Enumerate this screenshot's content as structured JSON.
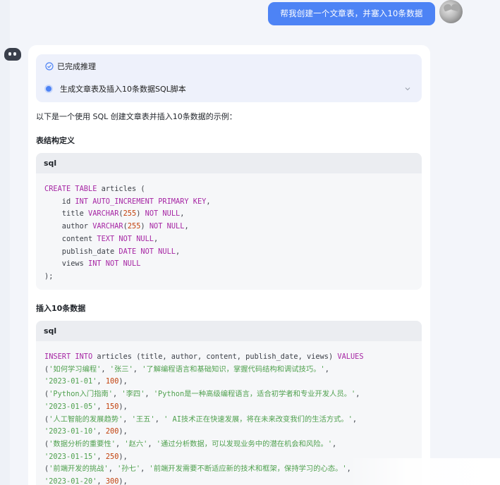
{
  "user_message": "帮我创建一个文章表，并塞入10条数据",
  "reasoning": {
    "status": "已完成推理",
    "step": "生成文章表及插入10条数据SQL脚本"
  },
  "response": {
    "intro": "以下是一个使用 SQL 创建文章表并插入10条数据的示例：",
    "section1_title": "表结构定义",
    "section2_title": "插入10条数据"
  },
  "code_blocks": [
    {
      "lang": "sql",
      "lines": [
        [
          [
            "kw",
            "CREATE TABLE"
          ],
          [
            "p",
            " articles ("
          ]
        ],
        [
          [
            "p",
            "    id "
          ],
          [
            "kw",
            "INT AUTO_INCREMENT PRIMARY KEY"
          ],
          [
            "p",
            ","
          ]
        ],
        [
          [
            "p",
            "    title "
          ],
          [
            "kw",
            "VARCHAR"
          ],
          [
            "p",
            "("
          ],
          [
            "num",
            "255"
          ],
          [
            "p",
            ") "
          ],
          [
            "kw",
            "NOT NULL"
          ],
          [
            "p",
            ","
          ]
        ],
        [
          [
            "p",
            "    author "
          ],
          [
            "kw",
            "VARCHAR"
          ],
          [
            "p",
            "("
          ],
          [
            "num",
            "255"
          ],
          [
            "p",
            ") "
          ],
          [
            "kw",
            "NOT NULL"
          ],
          [
            "p",
            ","
          ]
        ],
        [
          [
            "p",
            "    content "
          ],
          [
            "kw",
            "TEXT NOT NULL"
          ],
          [
            "p",
            ","
          ]
        ],
        [
          [
            "p",
            "    publish_date "
          ],
          [
            "kw",
            "DATE NOT NULL"
          ],
          [
            "p",
            ","
          ]
        ],
        [
          [
            "p",
            "    views "
          ],
          [
            "kw",
            "INT NOT NULL"
          ]
        ],
        [
          [
            "p",
            ");"
          ]
        ]
      ]
    },
    {
      "lang": "sql",
      "lines": [
        [
          [
            "kw",
            "INSERT INTO"
          ],
          [
            "p",
            " articles (title, author, content, publish_date, views) "
          ],
          [
            "kw",
            "VALUES"
          ]
        ],
        [
          [
            "p",
            "("
          ],
          [
            "str",
            "'如何学习编程'"
          ],
          [
            "p",
            ", "
          ],
          [
            "str",
            "'张三'"
          ],
          [
            "p",
            ", "
          ],
          [
            "str",
            "'了解编程语言和基础知识，掌握代码结构和调试技巧。'"
          ],
          [
            "p",
            ","
          ]
        ],
        [
          [
            "str",
            "'2023-01-01'"
          ],
          [
            "p",
            ", "
          ],
          [
            "num",
            "100"
          ],
          [
            "p",
            "),"
          ]
        ],
        [
          [
            "p",
            "("
          ],
          [
            "str",
            "'Python入门指南'"
          ],
          [
            "p",
            ", "
          ],
          [
            "str",
            "'李四'"
          ],
          [
            "p",
            ", "
          ],
          [
            "str",
            "'Python是一种高级编程语言，适合初学者和专业开发人员。'"
          ],
          [
            "p",
            ","
          ]
        ],
        [
          [
            "str",
            "'2023-01-05'"
          ],
          [
            "p",
            ", "
          ],
          [
            "num",
            "150"
          ],
          [
            "p",
            "),"
          ]
        ],
        [
          [
            "p",
            "("
          ],
          [
            "str",
            "'人工智能的发展趋势'"
          ],
          [
            "p",
            ", "
          ],
          [
            "str",
            "'王五'"
          ],
          [
            "p",
            ", "
          ],
          [
            "str",
            "' AI技术正在快速发展，将在未来改变我们的生活方式。'"
          ],
          [
            "p",
            ","
          ]
        ],
        [
          [
            "str",
            "'2023-01-10'"
          ],
          [
            "p",
            ", "
          ],
          [
            "num",
            "200"
          ],
          [
            "p",
            "),"
          ]
        ],
        [
          [
            "p",
            "("
          ],
          [
            "str",
            "'数据分析的重要性'"
          ],
          [
            "p",
            ", "
          ],
          [
            "str",
            "'赵六'"
          ],
          [
            "p",
            ", "
          ],
          [
            "str",
            "'通过分析数据，可以发现业务中的潜在机会和风险。'"
          ],
          [
            "p",
            ","
          ]
        ],
        [
          [
            "str",
            "'2023-01-15'"
          ],
          [
            "p",
            ", "
          ],
          [
            "num",
            "250"
          ],
          [
            "p",
            "),"
          ]
        ],
        [
          [
            "p",
            "("
          ],
          [
            "str",
            "'前端开发的挑战'"
          ],
          [
            "p",
            ", "
          ],
          [
            "str",
            "'孙七'"
          ],
          [
            "p",
            ", "
          ],
          [
            "str",
            "'前端开发需要不断适应新的技术和框架，保持学习的心态。'"
          ],
          [
            "p",
            ","
          ]
        ],
        [
          [
            "str",
            "'2023-01-20'"
          ],
          [
            "p",
            ", "
          ],
          [
            "num",
            "300"
          ],
          [
            "p",
            "),"
          ]
        ]
      ]
    }
  ],
  "colors": {
    "user_bubble": "#4d83f5",
    "keyword": "#a626a4",
    "string": "#50a14f",
    "number": "#c2410c"
  },
  "icons": {
    "reasoning_done": "check-circle-icon",
    "expand": "chevron-down-icon"
  }
}
